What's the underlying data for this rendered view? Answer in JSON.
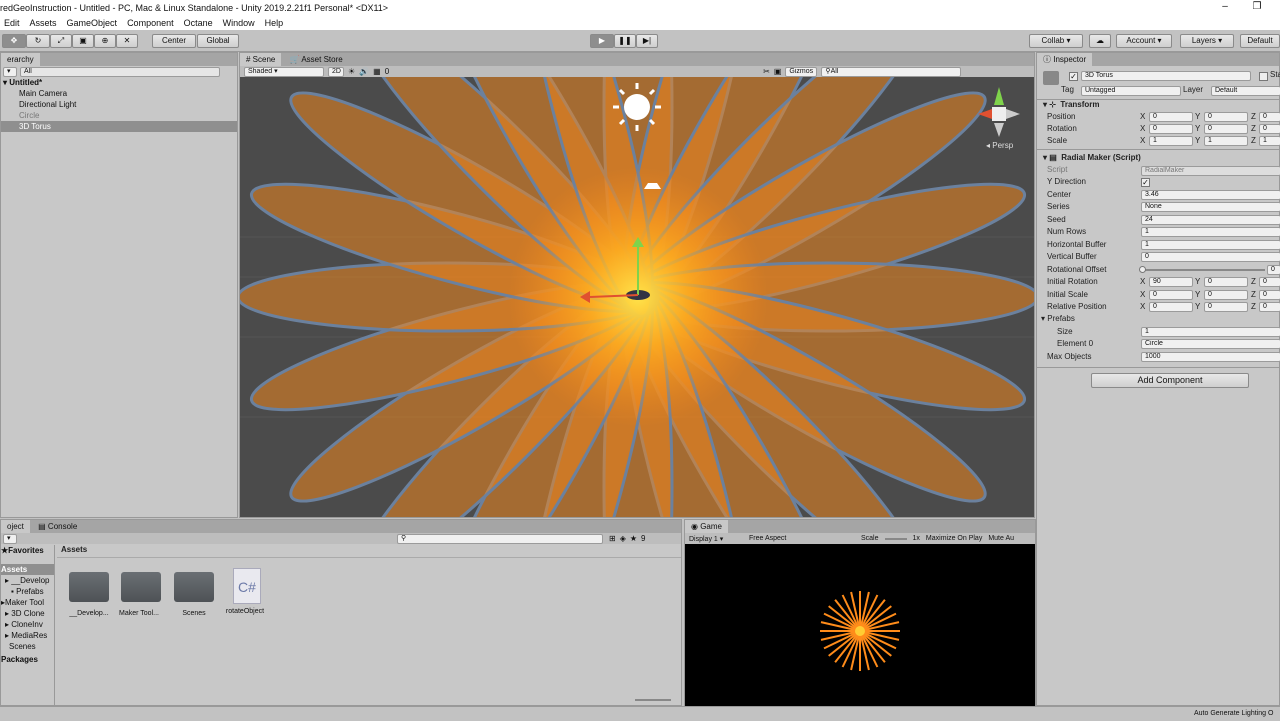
{
  "window": {
    "title": "redGeoInstruction - Untitled - PC, Mac & Linux Standalone - Unity 2019.2.21f1 Personal* <DX11>",
    "minimize": "–",
    "restore": "❐"
  },
  "menu": [
    "Edit",
    "Assets",
    "GameObject",
    "Component",
    "Octane",
    "Window",
    "Help"
  ],
  "toolbar": {
    "pivot": "Center",
    "space": "Global",
    "collab": "Collab",
    "account": "Account",
    "layers": "Layers",
    "layout": "Default"
  },
  "hierarchy": {
    "tab": "erarchy",
    "search_placeholder": "All",
    "scene": "Untitled*",
    "items": [
      "Main Camera",
      "Directional Light",
      "Circle",
      "3D Torus"
    ],
    "selected_index": 3
  },
  "scene": {
    "tabs": [
      "Scene",
      "Asset Store"
    ],
    "shading": "Shaded",
    "mode_2d": "2D",
    "fx_count": "0",
    "gizmos": "Gizmos",
    "search_placeholder": "All",
    "persp": "Persp"
  },
  "game": {
    "tab": "Game",
    "display": "Display 1",
    "aspect": "Free Aspect",
    "scale_label": "Scale",
    "scale_value": "1x",
    "maximize": "Maximize On Play",
    "mute": "Mute Au"
  },
  "project": {
    "tabs": [
      "oject",
      "Console"
    ],
    "favorites": "Favorites",
    "assets_header": "Assets",
    "count": "9",
    "tree": [
      "Assets",
      "__Develop",
      "Prefabs",
      "Maker Tool",
      "3D Clone",
      "CloneInv",
      "MediaRes",
      "Scenes",
      "Packages"
    ],
    "items": [
      {
        "name": "__Develop...",
        "kind": "folder"
      },
      {
        "name": "Maker Tool...",
        "kind": "folder"
      },
      {
        "name": "Scenes",
        "kind": "folder"
      },
      {
        "name": "rotateObject",
        "kind": "script"
      }
    ],
    "script_glyph": "C#"
  },
  "inspector": {
    "tab": "Inspector",
    "object_name": "3D Torus",
    "static_label": "Sta",
    "tag_label": "Tag",
    "tag_value": "Untagged",
    "layer_label": "Layer",
    "layer_value": "Default",
    "transform": {
      "title": "Transform",
      "rows": [
        {
          "label": "Position",
          "x": "0",
          "y": "0",
          "z": "0"
        },
        {
          "label": "Rotation",
          "x": "0",
          "y": "0",
          "z": "0"
        },
        {
          "label": "Scale",
          "x": "1",
          "y": "1",
          "z": "1"
        }
      ]
    },
    "radial": {
      "title": "Radial Maker (Script)",
      "script_label": "Script",
      "script_value": "RadialMaker",
      "y_direction": "Y Direction",
      "center_label": "Center",
      "center_value": "3.46",
      "series_label": "Series",
      "series_value": "None",
      "seed_label": "Seed",
      "seed_value": "24",
      "num_rows_label": "Num Rows",
      "num_rows_value": "1",
      "hbuf_label": "Horizontal Buffer",
      "hbuf_value": "1",
      "vbuf_label": "Vertical Buffer",
      "vbuf_value": "0",
      "rot_offset_label": "Rotational Offset",
      "rot_offset_value": "0",
      "init_rot_label": "Initial Rotation",
      "init_rot": {
        "x": "90",
        "y": "0",
        "z": "0"
      },
      "init_scale_label": "Initial Scale",
      "init_scale": {
        "x": "0",
        "y": "0",
        "z": "0"
      },
      "rel_pos_label": "Relative Position",
      "rel_pos": {
        "x": "0",
        "y": "0",
        "z": "0"
      },
      "prefabs_label": "Prefabs",
      "size_label": "Size",
      "size_value": "1",
      "element0_label": "Element 0",
      "element0_value": "Circle",
      "max_objects_label": "Max Objects",
      "max_objects_value": "1000"
    },
    "add_component": "Add Component"
  },
  "axis": {
    "x": "X",
    "y": "Y",
    "z": "Z"
  },
  "status": "Auto Generate Lighting O",
  "colors": {
    "accent_orange": "#ff8c1a",
    "scene_bg": "#4b4b4b",
    "selected_row": "#8f8f8f"
  }
}
